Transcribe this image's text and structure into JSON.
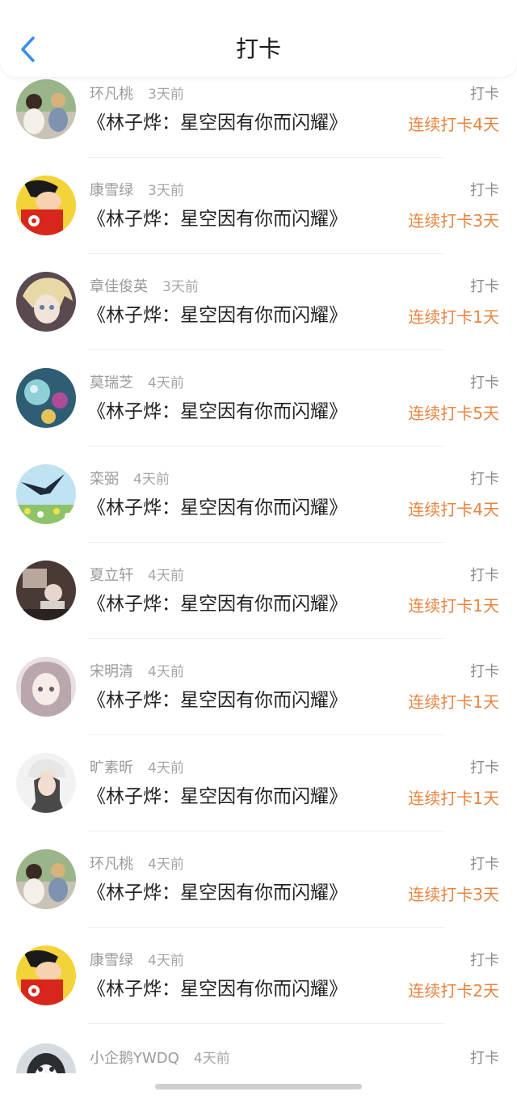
{
  "nav": {
    "title": "打卡"
  },
  "items": [
    {
      "name": "环凡桃",
      "time": "3天前",
      "title": "《林子烨：星空因有你而闪耀》",
      "action": "打卡",
      "streak": "连续打卡4天",
      "avatar_icon": "photo-avatar-children-icon"
    },
    {
      "name": "康雪绿",
      "time": "3天前",
      "title": "《林子烨：星空因有你而闪耀》",
      "action": "打卡",
      "streak": "连续打卡3天",
      "avatar_icon": "cartoon-avatar-icon"
    },
    {
      "name": "章佳俊英",
      "time": "3天前",
      "title": "《林子烨：星空因有你而闪耀》",
      "action": "打卡",
      "streak": "连续打卡1天",
      "avatar_icon": "anime-avatar-icon"
    },
    {
      "name": "莫瑞芝",
      "time": "4天前",
      "title": "《林子烨：星空因有你而闪耀》",
      "action": "打卡",
      "streak": "连续打卡5天",
      "avatar_icon": "glass-ball-avatar-icon"
    },
    {
      "name": "栾弼",
      "time": "4天前",
      "title": "《林子烨：星空因有你而闪耀》",
      "action": "打卡",
      "streak": "连续打卡4天",
      "avatar_icon": "bird-avatar-icon"
    },
    {
      "name": "夏立轩",
      "time": "4天前",
      "title": "《林子烨：星空因有你而闪耀》",
      "action": "打卡",
      "streak": "连续打卡1天",
      "avatar_icon": "photo-avatar-icon"
    },
    {
      "name": "宋明清",
      "time": "4天前",
      "title": "《林子烨：星空因有你而闪耀》",
      "action": "打卡",
      "streak": "连续打卡1天",
      "avatar_icon": "anime-girl-avatar-icon"
    },
    {
      "name": "旷素昕",
      "time": "4天前",
      "title": "《林子烨：星空因有你而闪耀》",
      "action": "打卡",
      "streak": "连续打卡1天",
      "avatar_icon": "person-avatar-icon"
    },
    {
      "name": "环凡桃",
      "time": "4天前",
      "title": "《林子烨：星空因有你而闪耀》",
      "action": "打卡",
      "streak": "连续打卡3天",
      "avatar_icon": "photo-avatar-children-icon"
    },
    {
      "name": "康雪绿",
      "time": "4天前",
      "title": "《林子烨：星空因有你而闪耀》",
      "action": "打卡",
      "streak": "连续打卡2天",
      "avatar_icon": "cartoon-avatar-icon"
    },
    {
      "name": "小企鹅YWDQ",
      "time": "4天前",
      "title": "",
      "action": "打卡",
      "streak": "",
      "avatar_icon": "penguin-avatar-icon"
    }
  ],
  "colors": {
    "accent_blue": "#3a8ee6",
    "streak_orange": "#e8843f"
  }
}
